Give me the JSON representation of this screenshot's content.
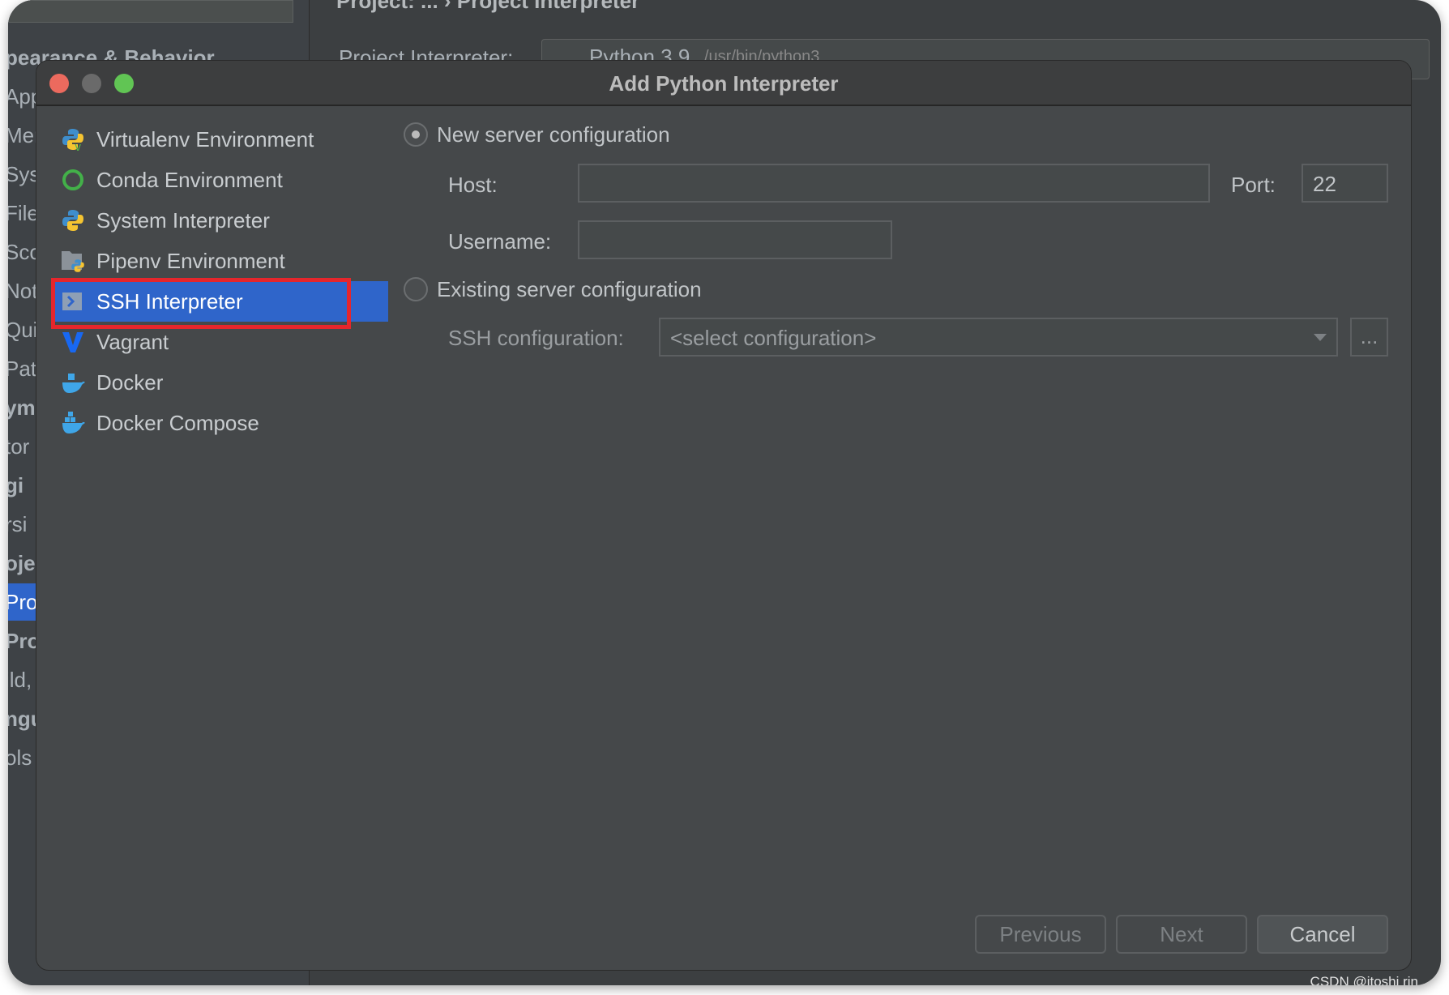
{
  "background": {
    "sidebar_fragments": [
      "pearance & Behavior",
      "App",
      "Mer",
      "Sys",
      "File",
      "Sco",
      "Not",
      "Qui",
      "Pat",
      "ym",
      "tor",
      "gi",
      "rsi",
      "oje",
      "Pro",
      "Pro",
      "ild,",
      "ngu",
      "ols"
    ],
    "header_fragment": "Project: ... › Project Interpreter",
    "project_interpreter_label": "Project Interpreter:",
    "interpreter_value": "Python 3.9",
    "interpreter_path": "/usr/bin/python3"
  },
  "dialog": {
    "title": "Add Python Interpreter",
    "types": [
      {
        "label": "Virtualenv Environment",
        "icon": "virtualenv-icon"
      },
      {
        "label": "Conda Environment",
        "icon": "conda-icon"
      },
      {
        "label": "System Interpreter",
        "icon": "python-icon"
      },
      {
        "label": "Pipenv Environment",
        "icon": "pipenv-icon"
      },
      {
        "label": "SSH Interpreter",
        "icon": "ssh-icon",
        "selected": true
      },
      {
        "label": "Vagrant",
        "icon": "vagrant-icon"
      },
      {
        "label": "Docker",
        "icon": "docker-icon"
      },
      {
        "label": "Docker Compose",
        "icon": "docker-compose-icon"
      }
    ],
    "new_server": {
      "label": "New server configuration",
      "selected": true,
      "host_label": "Host:",
      "host_value": "",
      "port_label": "Port:",
      "port_value": "22",
      "username_label": "Username:",
      "username_value": ""
    },
    "existing_server": {
      "label": "Existing server configuration",
      "selected": false,
      "ssh_config_label": "SSH configuration:",
      "ssh_config_placeholder": "<select configuration>",
      "browse_label": "..."
    },
    "buttons": {
      "previous": "Previous",
      "next": "Next",
      "cancel": "Cancel"
    },
    "colors": {
      "selection": "#2f65ca",
      "highlight_box": "#e5262c"
    }
  },
  "watermark": "CSDN @itoshi rin"
}
